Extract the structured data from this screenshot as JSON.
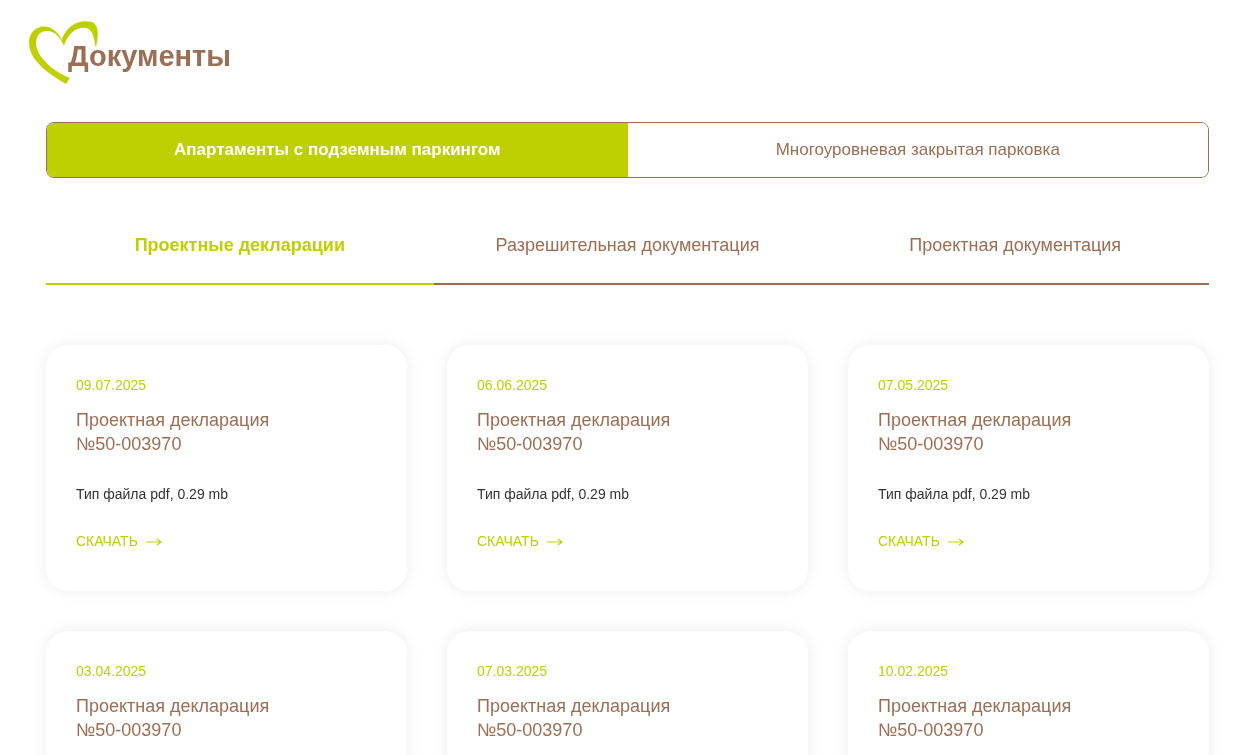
{
  "page_title": "Документы",
  "object_tabs": [
    {
      "label": "Апартаменты с подземным паркингом",
      "selected": true
    },
    {
      "label": "Многоуровневая закрытая парковка",
      "selected": false
    }
  ],
  "doc_tabs": [
    {
      "label": "Проектные декларации",
      "selected": true
    },
    {
      "label": "Разрешительная документация",
      "selected": false
    },
    {
      "label": "Проектная документация",
      "selected": false
    }
  ],
  "documents": [
    {
      "date": "09.07.2025",
      "title": "Проектная декларация №50-003970",
      "file_info": "Тип файла pdf, 0.29 mb",
      "download": "СКАЧАТЬ"
    },
    {
      "date": "06.06.2025",
      "title": "Проектная декларация №50-003970",
      "file_info": "Тип файла pdf, 0.29 mb",
      "download": "СКАЧАТЬ"
    },
    {
      "date": "07.05.2025",
      "title": "Проектная декларация №50-003970",
      "file_info": "Тип файла pdf, 0.29 mb",
      "download": "СКАЧАТЬ"
    },
    {
      "date": "03.04.2025",
      "title": "Проектная декларация №50-003970"
    },
    {
      "date": "07.03.2025",
      "title": "Проектная декларация №50-003970"
    },
    {
      "date": "10.02.2025",
      "title": "Проектная декларация №50-003970"
    }
  ]
}
